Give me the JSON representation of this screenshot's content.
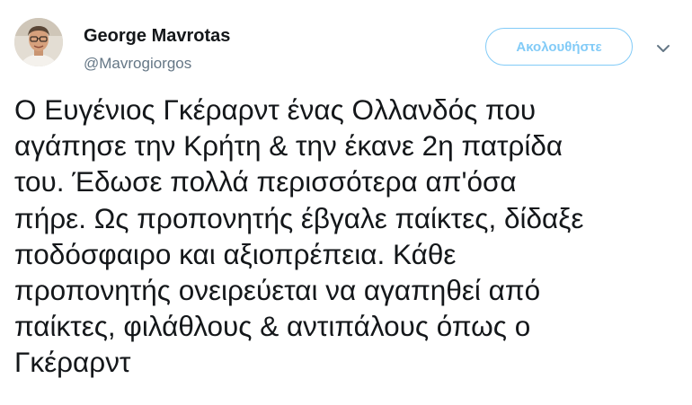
{
  "author": {
    "display_name": "George Mavrotas",
    "handle": "@Mavrogiorgos",
    "avatar_icon": "user-avatar-photo"
  },
  "actions": {
    "follow_label": "Ακολουθήστε",
    "more_icon": "chevron-down-icon"
  },
  "tweet": {
    "lines": [
      "Ο Ευγένιος Γκέραρντ ένας Ολλανδός που",
      "αγάπησε την Κρήτη & την έκανε 2η πατρίδα",
      "του. Έδωσε πολλά περισσότερα απ'όσα",
      "πήρε. Ως προπονητής έβγαλε παίκτες, δίδαξε",
      "ποδόσφαιρο και αξιοπρέπεια. Κάθε",
      "προπονητής ονειρεύεται να αγαπηθεί από",
      "παίκτες, φιλάθλους & αντιπάλους όπως ο",
      "Γκέραρντ"
    ]
  },
  "colors": {
    "accent": "#1da1f2",
    "text": "#14171a",
    "secondary_text": "#657786"
  }
}
